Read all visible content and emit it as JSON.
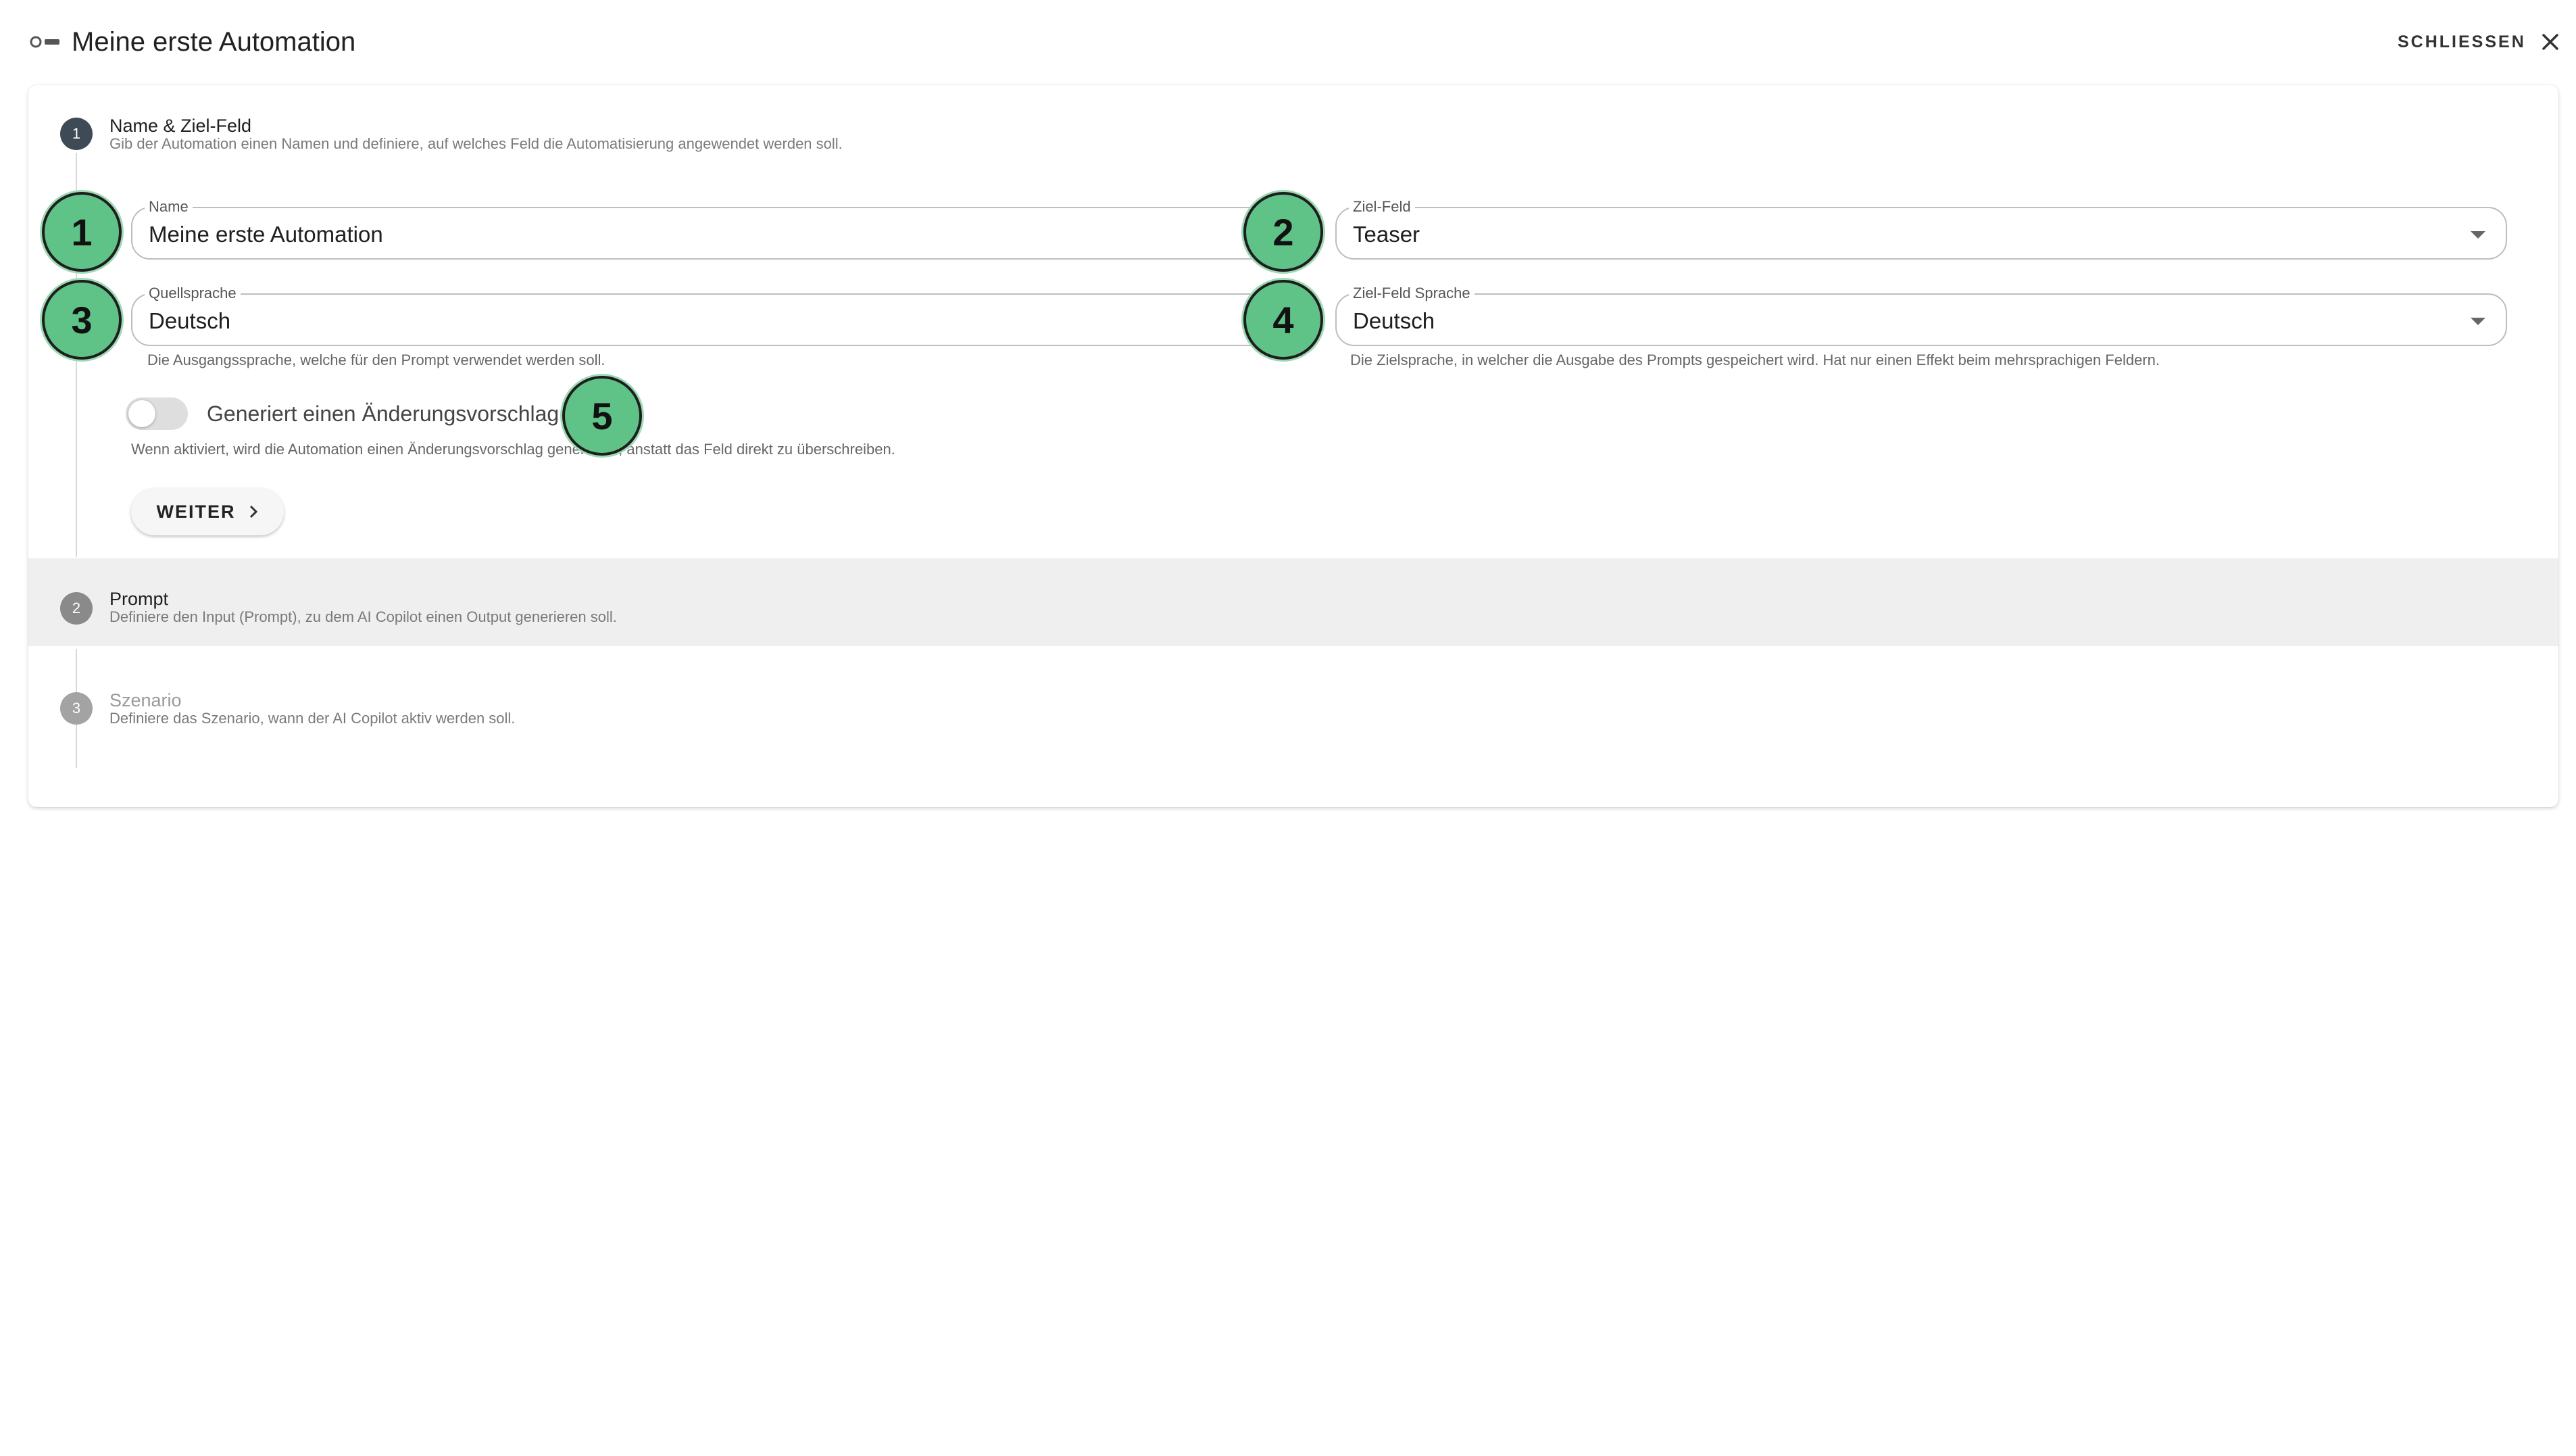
{
  "header": {
    "title": "Meine erste Automation",
    "close_label": "SCHLIESSEN"
  },
  "steps": [
    {
      "number": "1",
      "title": "Name & Ziel-Feld",
      "subtitle": "Gib der Automation einen Namen und definiere, auf welches Feld die Automatisierung angewendet werden soll.",
      "state": "active"
    },
    {
      "number": "2",
      "title": "Prompt",
      "subtitle": "Definiere den Input (Prompt), zu dem AI Copilot einen Output generieren soll.",
      "state": "pending"
    },
    {
      "number": "3",
      "title": "Szenario",
      "subtitle": "Definiere das Szenario, wann der AI Copilot aktiv werden soll.",
      "state": "disabled"
    }
  ],
  "form": {
    "name": {
      "label": "Name",
      "value": "Meine erste Automation"
    },
    "target_field": {
      "label": "Ziel-Feld",
      "value": "Teaser"
    },
    "source_language": {
      "label": "Quellsprache",
      "value": "Deutsch",
      "hint": "Die Ausgangssprache, welche für den Prompt verwendet werden soll."
    },
    "target_language": {
      "label": "Ziel-Feld Sprache",
      "value": "Deutsch",
      "hint": "Die Zielsprache, in welcher die Ausgabe des Prompts gespeichert wird. Hat nur einen Effekt beim mehrsprachigen Feldern."
    },
    "suggestion_toggle": {
      "label": "Generiert einen Änderungsvorschlag",
      "hint": "Wenn aktiviert, wird die Automation einen Änderungsvorschlag generieren, anstatt das Feld direkt zu überschreiben.",
      "checked": false
    },
    "next_label": "WEITER"
  },
  "annotations": [
    "1",
    "2",
    "3",
    "4",
    "5"
  ],
  "colors": {
    "badge": "#5fc387",
    "active_step": "#3e4a55",
    "band": "#efefef"
  }
}
